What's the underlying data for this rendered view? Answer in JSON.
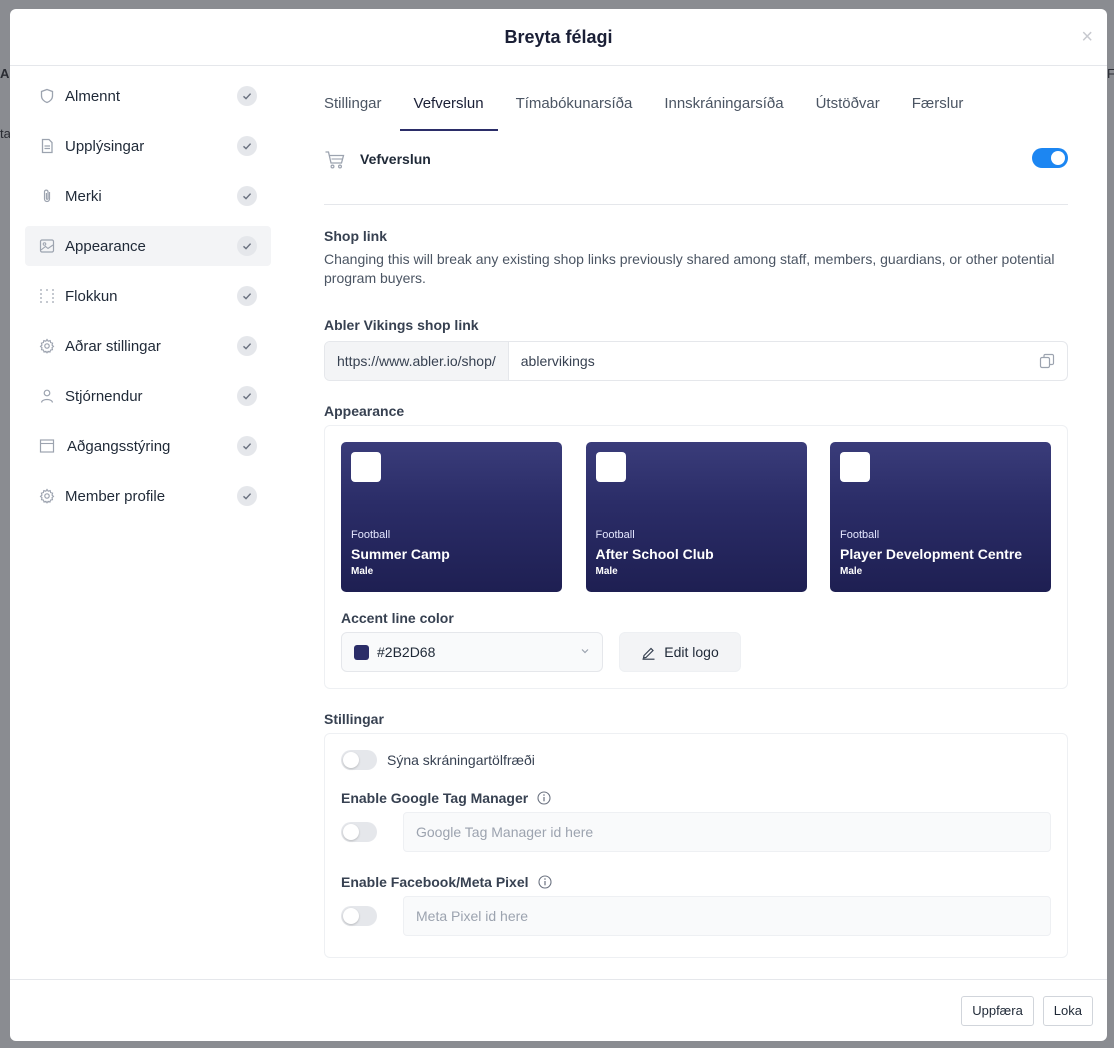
{
  "background": {
    "frag_left": "Al",
    "frag_left2": "ta",
    "frag_right": "Fo"
  },
  "modal": {
    "title": "Breyta félagi"
  },
  "sidebar": {
    "items": [
      {
        "label": "Almennt",
        "icon": "shield-icon"
      },
      {
        "label": "Upplýsingar",
        "icon": "document-icon"
      },
      {
        "label": "Merki",
        "icon": "paperclip-icon"
      },
      {
        "label": "Appearance",
        "icon": "image-icon"
      },
      {
        "label": "Flokkun",
        "icon": "grid-icon"
      },
      {
        "label": "Aðrar stillingar",
        "icon": "gear-icon"
      },
      {
        "label": "Stjórnendur",
        "icon": "user-icon"
      },
      {
        "label": "Aðgangsstýring",
        "icon": "archive-icon"
      },
      {
        "label": "Member profile",
        "icon": "gear-icon"
      }
    ],
    "active_index": 3
  },
  "tabs": [
    "Stillingar",
    "Vefverslun",
    "Tímabókunarsíða",
    "Innskráningarsíða",
    "Útstöðvar",
    "Færslur"
  ],
  "active_tab": "Vefverslun",
  "webshop": {
    "title": "Vefverslun",
    "enabled": true
  },
  "shop_link": {
    "title": "Shop link",
    "description": "Changing this will break any existing shop links previously shared among staff, members, guardians, or other potential program buyers.",
    "field_label": "Abler Vikings shop link",
    "prefix": "https://www.abler.io/shop/",
    "value": "ablervikings"
  },
  "appearance": {
    "title": "Appearance",
    "cards": [
      {
        "sport": "Football",
        "name": "Summer Camp",
        "gender": "Male"
      },
      {
        "sport": "Football",
        "name": "After School Club",
        "gender": "Male"
      },
      {
        "sport": "Football",
        "name": "Player Development Centre",
        "gender": "Male"
      }
    ],
    "accent_label": "Accent line color",
    "accent_color": "#2B2D68",
    "edit_logo_label": "Edit logo"
  },
  "settings": {
    "title": "Stillingar",
    "show_stats_label": "Sýna skráningartölfræði",
    "gtm_label": "Enable Google Tag Manager",
    "gtm_placeholder": "Google Tag Manager id here",
    "fb_label": "Enable Facebook/Meta Pixel",
    "fb_placeholder": "Meta Pixel id here"
  },
  "footer": {
    "update_label": "Uppfæra",
    "close_label": "Loka"
  },
  "colors": {
    "accent": "#2B2D68",
    "toggle_on": "#1C86F2"
  }
}
